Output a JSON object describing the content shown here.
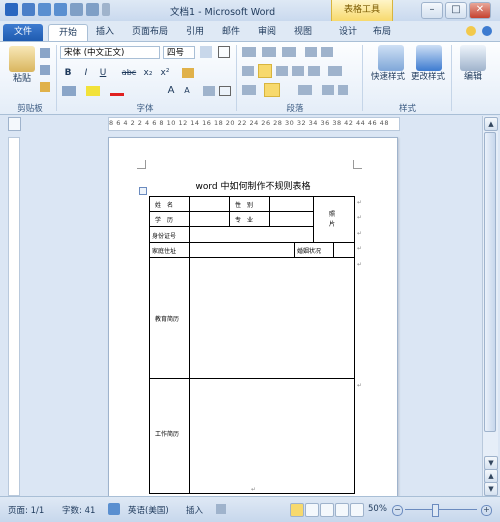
{
  "window": {
    "title": "文档1 - Microsoft Word",
    "contextual_tab_group": "表格工具",
    "buttons": {
      "minimize": "–",
      "maximize": "□",
      "close": "✕"
    }
  },
  "tabs": [
    "文件",
    "开始",
    "插入",
    "页面布局",
    "引用",
    "邮件",
    "审阅",
    "视图",
    "设计",
    "布局"
  ],
  "ribbon": {
    "clipboard": {
      "paste": "粘贴",
      "label": "剪贴板"
    },
    "font": {
      "name": "宋体 (中文正文)",
      "size": "四号",
      "bold": "B",
      "italic": "I",
      "underline": "U",
      "strike": "abc",
      "sub": "x₂",
      "sup": "x²",
      "grow": "A",
      "shrink": "A",
      "label": "字体"
    },
    "paragraph": {
      "label": "段落"
    },
    "styles": {
      "quick": "快速样式",
      "change": "更改样式",
      "label": "样式"
    },
    "editing": {
      "label": "编辑"
    }
  },
  "ruler": {
    "horizontal": "8  6  4  2        2  4  6  8  10  12  14  16  18  20  22  24  26  28  30  32  34  36  38     42  44  46  48"
  },
  "document": {
    "title": "word 中如何制作不规则表格",
    "table": {
      "name_label": "姓　名",
      "gender_label": "性　别",
      "education_label": "学　历",
      "major_label": "专　业",
      "photo_label": "照\n片",
      "id_label": "身份证号",
      "address_label": "家庭住址",
      "marital_label": "婚姻状况",
      "edu_history_label": "教育简历",
      "work_history_label": "工作简历"
    }
  },
  "status": {
    "page": "页面: 1/1",
    "words": "字数: 41",
    "language": "英语(美国)",
    "mode": "插入",
    "zoom": "50%"
  },
  "colors": {
    "file_tab": "#2a67c0",
    "contextual": "#f7d96d",
    "ribbon_bg": "#e4edf8"
  }
}
